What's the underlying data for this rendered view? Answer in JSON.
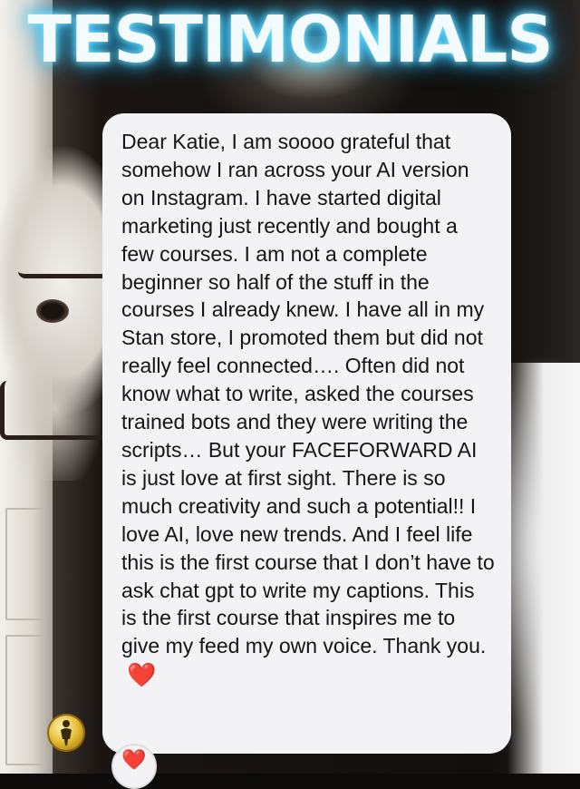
{
  "header": {
    "title": "TESTIMONIALS"
  },
  "message": {
    "text": "Dear Katie, I am soooo grateful that somehow I ran across your AI version on Instagram. I have started digital marketing just recently and bought a few courses. I am not a complete beginner so half of the stuff in the courses I already knew. I have all in my Stan store, I promoted them but did not really feel connected…. Often did not know what to write, asked the courses trained bots and they were writing the scripts… But your FACEFORWARD AI is just love at first sight. There is so much creativity and such a potential!! I love AI, love new trends. And I feel life this is the first course that I don’t have to ask chat gpt to write my captions. This is the first course that inspires me to give my feed my own voice. Thank you.",
    "emoji": "❤️"
  },
  "reaction": {
    "emoji": "❤️"
  },
  "icons": {
    "coin": "gold-coin-icon",
    "heart": "heart-icon"
  },
  "colors": {
    "title_glow": "#39c6ff",
    "bubble": "#f3f3f5",
    "heart": "#e11928"
  }
}
